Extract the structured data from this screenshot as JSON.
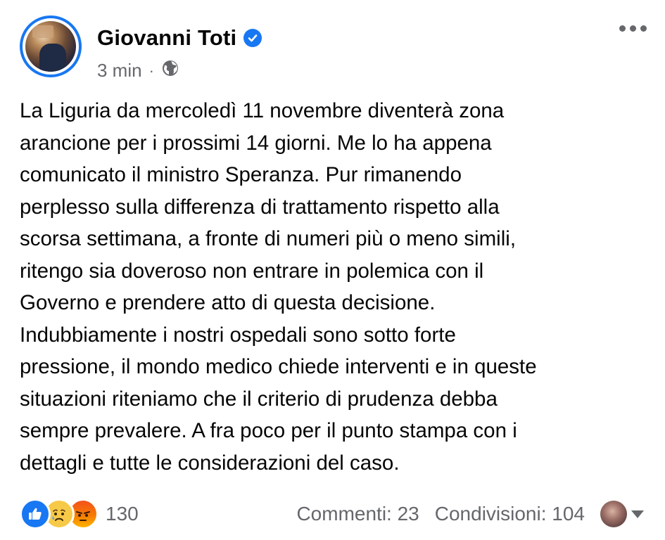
{
  "post": {
    "author": "Giovanni Toti",
    "verified": true,
    "time": "3 min",
    "separator": "·",
    "audience_icon": "globe-icon",
    "text": "La Liguria da mercoledì 11 novembre diventerà zona\narancione per i prossimi 14 giorni. Me lo ha appena\ncomunicato il ministro Speranza. Pur rimanendo\nperplesso sulla differenza di trattamento rispetto alla\nscorsa settimana, a fronte di numeri più o meno simili,\nritengo sia doveroso non entrare in polemica con il\nGoverno e prendere atto di questa decisione.\nIndubbiamente i nostri ospedali sono sotto forte\npressione, il mondo medico chiede interventi e in queste\nsituazioni riteniamo che il criterio di prudenza debba\nsempre prevalere. A fra poco per il punto stampa con i\ndettagli e tutte le considerazioni del caso."
  },
  "reactions": {
    "icons": [
      "like-reaction-icon",
      "sad-reaction-icon",
      "angry-reaction-icon"
    ],
    "count": "130"
  },
  "stats": {
    "comments": "Commenti: 23",
    "shares": "Condivisioni: 104"
  },
  "colors": {
    "accent": "#1877f2",
    "secondary_text": "#65676b",
    "text": "#050505"
  }
}
